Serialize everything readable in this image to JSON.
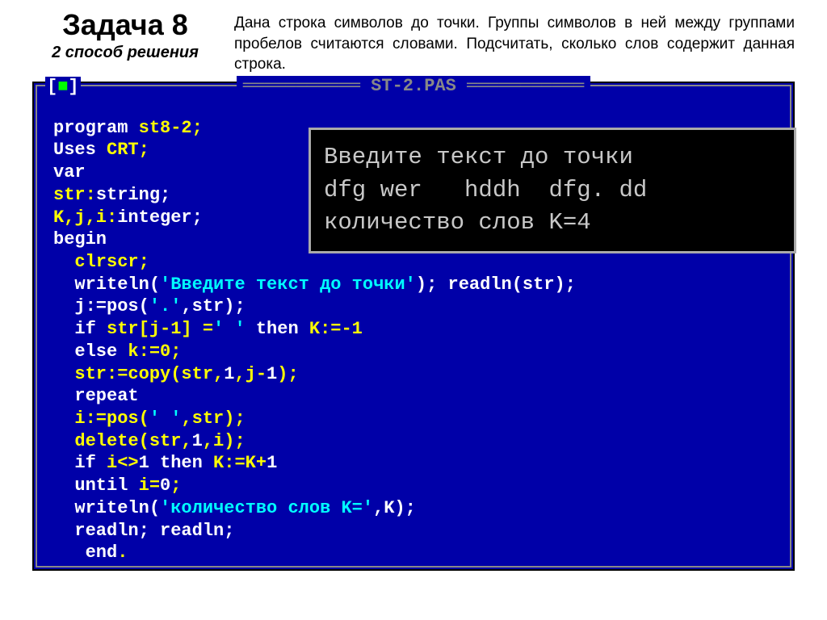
{
  "header": {
    "title": "Задача 8",
    "subtitle": "2 способ решения",
    "description": "Дана строка символов до точки. Группы символов в ней между группами пробелов считаются словами. Подсчитать, сколько слов содержит данная строка."
  },
  "editor": {
    "filename": " ST-2.PAS ",
    "close_left": "[",
    "close_sq": "■",
    "close_right": "]"
  },
  "code": {
    "l1_kw": "program ",
    "l1_id": "st8-2;",
    "l2_kw": "Uses ",
    "l2_id": "CRT;",
    "l3": "var",
    "l4_id": "str:",
    "l4_kw": "string;",
    "l5_id": "K,j,i:",
    "l5_kw": "integer;",
    "l6": "begin",
    "l7_id": "  clrscr;",
    "l8a": "  writeln(",
    "l8s": "'Введите текст до точки'",
    "l8b": "); readln(str);",
    "l9a": "  j:=pos(",
    "l9s": "'.'",
    "l9b": ",str);",
    "l10a": "  if ",
    "l10b": "str[j-1] =",
    "l10s": "' '",
    "l10c": " then ",
    "l10d": "K:=-1",
    "l11a": "  else ",
    "l11b": "k:=0;",
    "l12a": "  str:=copy(str,",
    "l12b": "1",
    "l12c": ",j-",
    "l12d": "1",
    "l12e": ");",
    "l13": "  repeat",
    "l14a": "  i:=pos(",
    "l14s": "' '",
    "l14b": ",str);",
    "l15a": "  delete(str,",
    "l15b": "1",
    "l15c": ",i);",
    "l16a": "  if ",
    "l16b": "i<>",
    "l16c": "1",
    "l16d": " then ",
    "l16e": "K:=K+",
    "l16f": "1",
    "l17a": "  until ",
    "l17b": "i=",
    "l17c": "0",
    "l17d": ";",
    "l18a": "  writeln(",
    "l18s": "'количество слов K='",
    "l18b": ",K);",
    "l19": "  readln; readln;",
    "l20a": "   end",
    "l20b": "."
  },
  "console": {
    "line1": "Введите текст до точки",
    "line2": "dfg wer   hddh  dfg. dd",
    "line3": "количество слов K=4"
  }
}
